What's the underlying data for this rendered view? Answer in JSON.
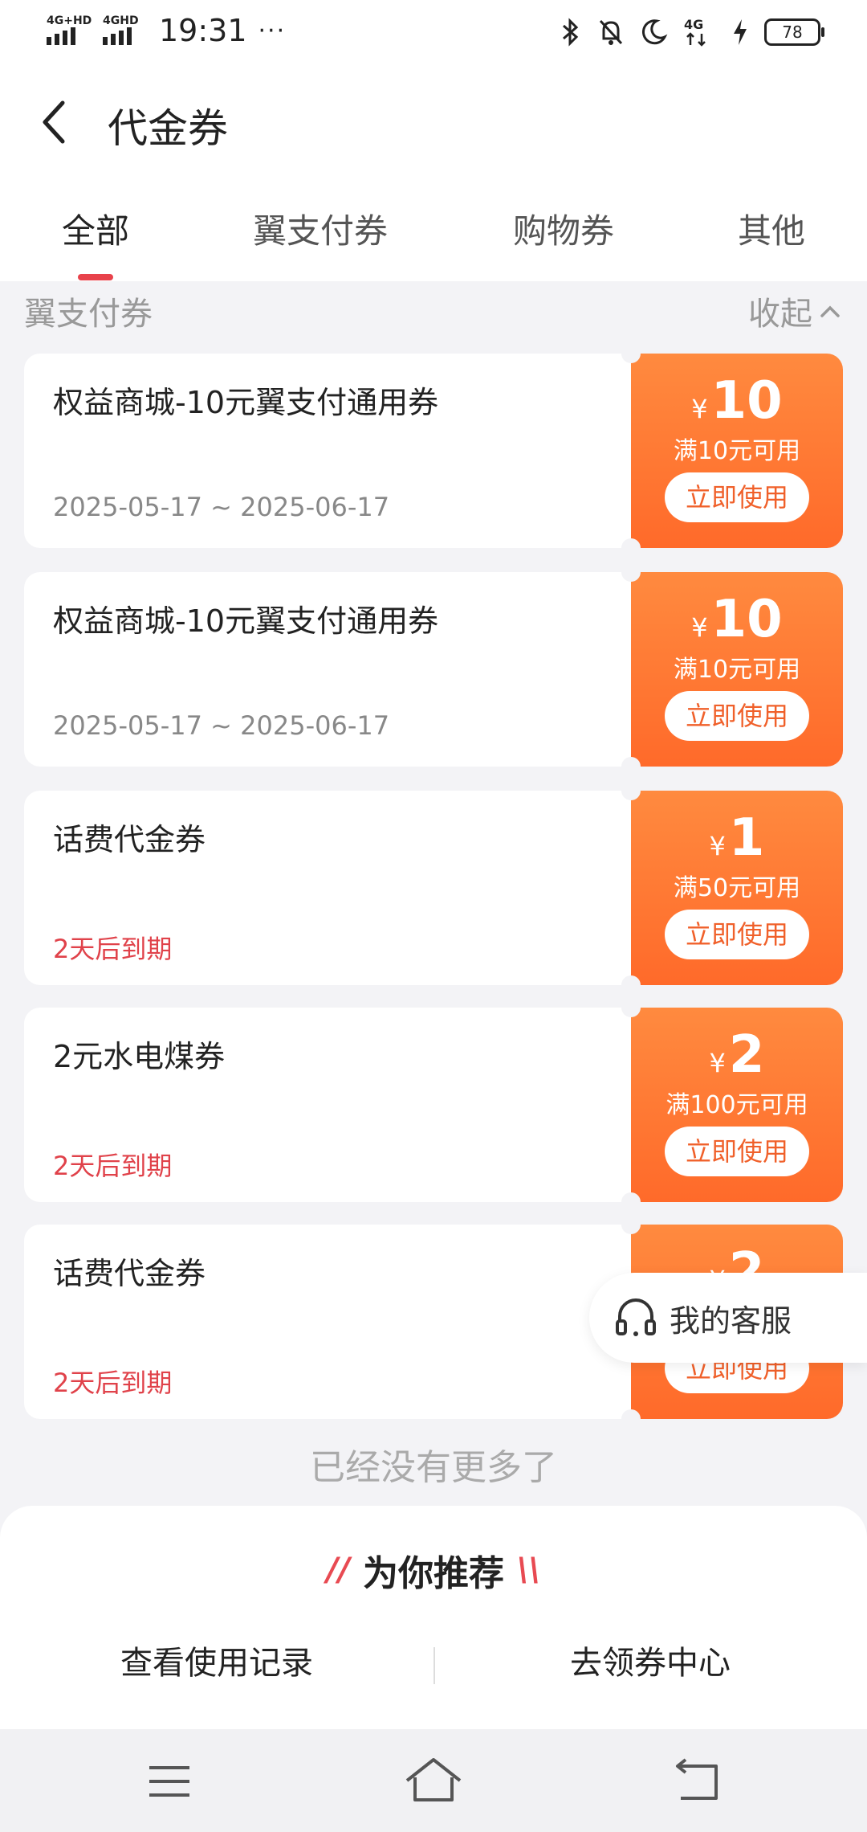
{
  "status_bar": {
    "network1": "4G+HD",
    "network2": "4GHD",
    "time": "19:31",
    "more": "···",
    "network3": "4G",
    "battery": "78"
  },
  "header": {
    "title": "代金券"
  },
  "tabs": [
    {
      "label": "全部",
      "active": true
    },
    {
      "label": "翼支付券",
      "active": false
    },
    {
      "label": "购物券",
      "active": false
    },
    {
      "label": "其他",
      "active": false
    }
  ],
  "section": {
    "title": "翼支付券",
    "collapse_label": "收起"
  },
  "coupons": [
    {
      "name": "权益商城-10元翼支付通用券",
      "validity": "2025-05-17 ~ 2025-06-17",
      "currency": "¥",
      "amount": "10",
      "condition": "满10元可用",
      "button": "立即使用"
    },
    {
      "name": "权益商城-10元翼支付通用券",
      "validity": "2025-05-17 ~ 2025-06-17",
      "currency": "¥",
      "amount": "10",
      "condition": "满10元可用",
      "button": "立即使用"
    },
    {
      "name": "话费代金券",
      "validity": "2天后到期",
      "currency": "¥",
      "amount": "1",
      "condition": "满50元可用",
      "button": "立即使用"
    },
    {
      "name": "2元水电煤券",
      "validity": "2天后到期",
      "currency": "¥",
      "amount": "2",
      "condition": "满100元可用",
      "button": "立即使用"
    },
    {
      "name": "话费代金券",
      "validity": "2天后到期",
      "currency": "¥",
      "amount": "2",
      "condition": "",
      "button": "立即使用"
    }
  ],
  "customer_service": {
    "label": "我的客服"
  },
  "no_more": "已经没有更多了",
  "recommend": {
    "title": "为你推荐"
  },
  "bottom_actions": {
    "history": "查看使用记录",
    "center": "去领券中心"
  },
  "colors": {
    "accent_red": "#e8424b",
    "coupon_orange": "#ff6a2a",
    "expiry_red": "#e0424a"
  }
}
